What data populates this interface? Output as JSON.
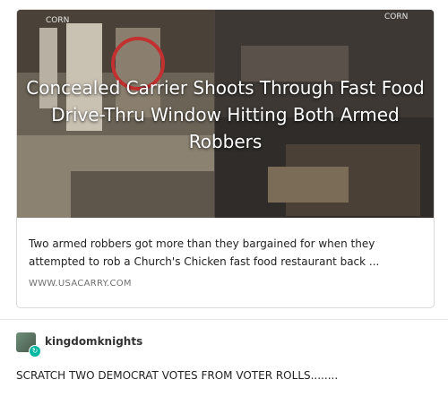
{
  "link_card": {
    "title": "Concealed Carrier Shoots Through Fast Food Drive-Thru Window Hitting Both Armed Robbers",
    "description": "Two armed robbers got more than they bargained for when they attempted to rob a Church's Chicken fast food restaurant back ...",
    "source": "WWW.USACARRY.COM",
    "image_watermark": "CORN"
  },
  "post": {
    "username": "kingdomknights",
    "body": "SCRATCH TWO DEMOCRAT VOTES FROM VOTER ROLLS........",
    "reblog_icon": "reblog-icon"
  },
  "colors": {
    "highlight_circle": "#c2302f",
    "card_border": "#d9d9d9",
    "reblog_badge": "#00b8a0"
  }
}
